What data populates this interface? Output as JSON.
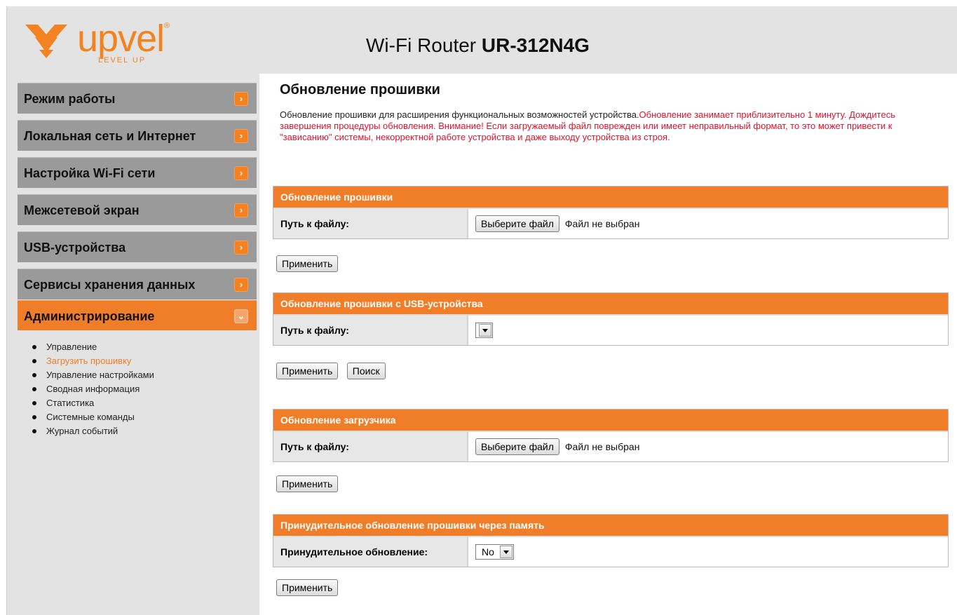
{
  "header": {
    "logo_text": "upvel",
    "logo_tagline": "LEVEL UP",
    "logo_reg": "®",
    "title_prefix": "Wi-Fi Router",
    "title_model": "UR-312N4G"
  },
  "sidebar": {
    "items": [
      {
        "label": "Режим работы",
        "icon": "chevron-right-icon"
      },
      {
        "label": "Локальная сеть и Интернет",
        "icon": "chevron-right-icon"
      },
      {
        "label": "Настройка Wi-Fi сети",
        "icon": "chevron-right-icon"
      },
      {
        "label": "Межсетевой экран",
        "icon": "chevron-right-icon"
      },
      {
        "label": "USB-устройства",
        "icon": "chevron-right-icon"
      },
      {
        "label": "Сервисы хранения данных",
        "icon": "chevron-right-icon"
      },
      {
        "label": "Администрирование",
        "icon": "chevron-down-icon",
        "active": true
      }
    ],
    "submenu": [
      "Управление",
      "Загрузить прошивку",
      "Управление настройками",
      "Сводная информация",
      "Статистика",
      "Системные команды",
      "Журнал событий"
    ],
    "submenu_current_index": 1
  },
  "main": {
    "page_title": "Обновление прошивки",
    "description_normal": "Обновление прошивки для расширения функциональных возможностей устройства.",
    "description_warning": "Обновление занимает приблизительно 1 минуту. Дождитесь завершения процедуры обновления. Внимание! Если загружаемый файл поврежден или имеет неправильный формат, то это может привести к \"зависанию\" системы, некорректной работе устройства и даже выходу устройства из строя.",
    "panels": [
      {
        "title": "Обновление прошивки",
        "row_label": "Путь к файлу:",
        "file_button": "Выберите файл",
        "file_status": "Файл не выбран",
        "buttons": [
          "Применить"
        ]
      },
      {
        "title": "Обновление прошивки с USB-устройства",
        "row_label": "Путь к файлу:",
        "select_value": "",
        "buttons": [
          "Применить",
          "Поиск"
        ]
      },
      {
        "title": "Обновление загрузчика",
        "row_label": "Путь к файлу:",
        "file_button": "Выберите файл",
        "file_status": "Файл не выбран",
        "buttons": [
          "Применить"
        ]
      },
      {
        "title": "Принудительное обновление прошивки через память",
        "row_label": "Принудительное обновление:",
        "select_value": "No",
        "buttons": [
          "Применить"
        ]
      }
    ]
  },
  "colors": {
    "accent": "#f07d28",
    "warning_text": "#e8102a",
    "sidebar_bg": "#e3e3e3",
    "menu_item_bg": "#9a9a9a"
  }
}
